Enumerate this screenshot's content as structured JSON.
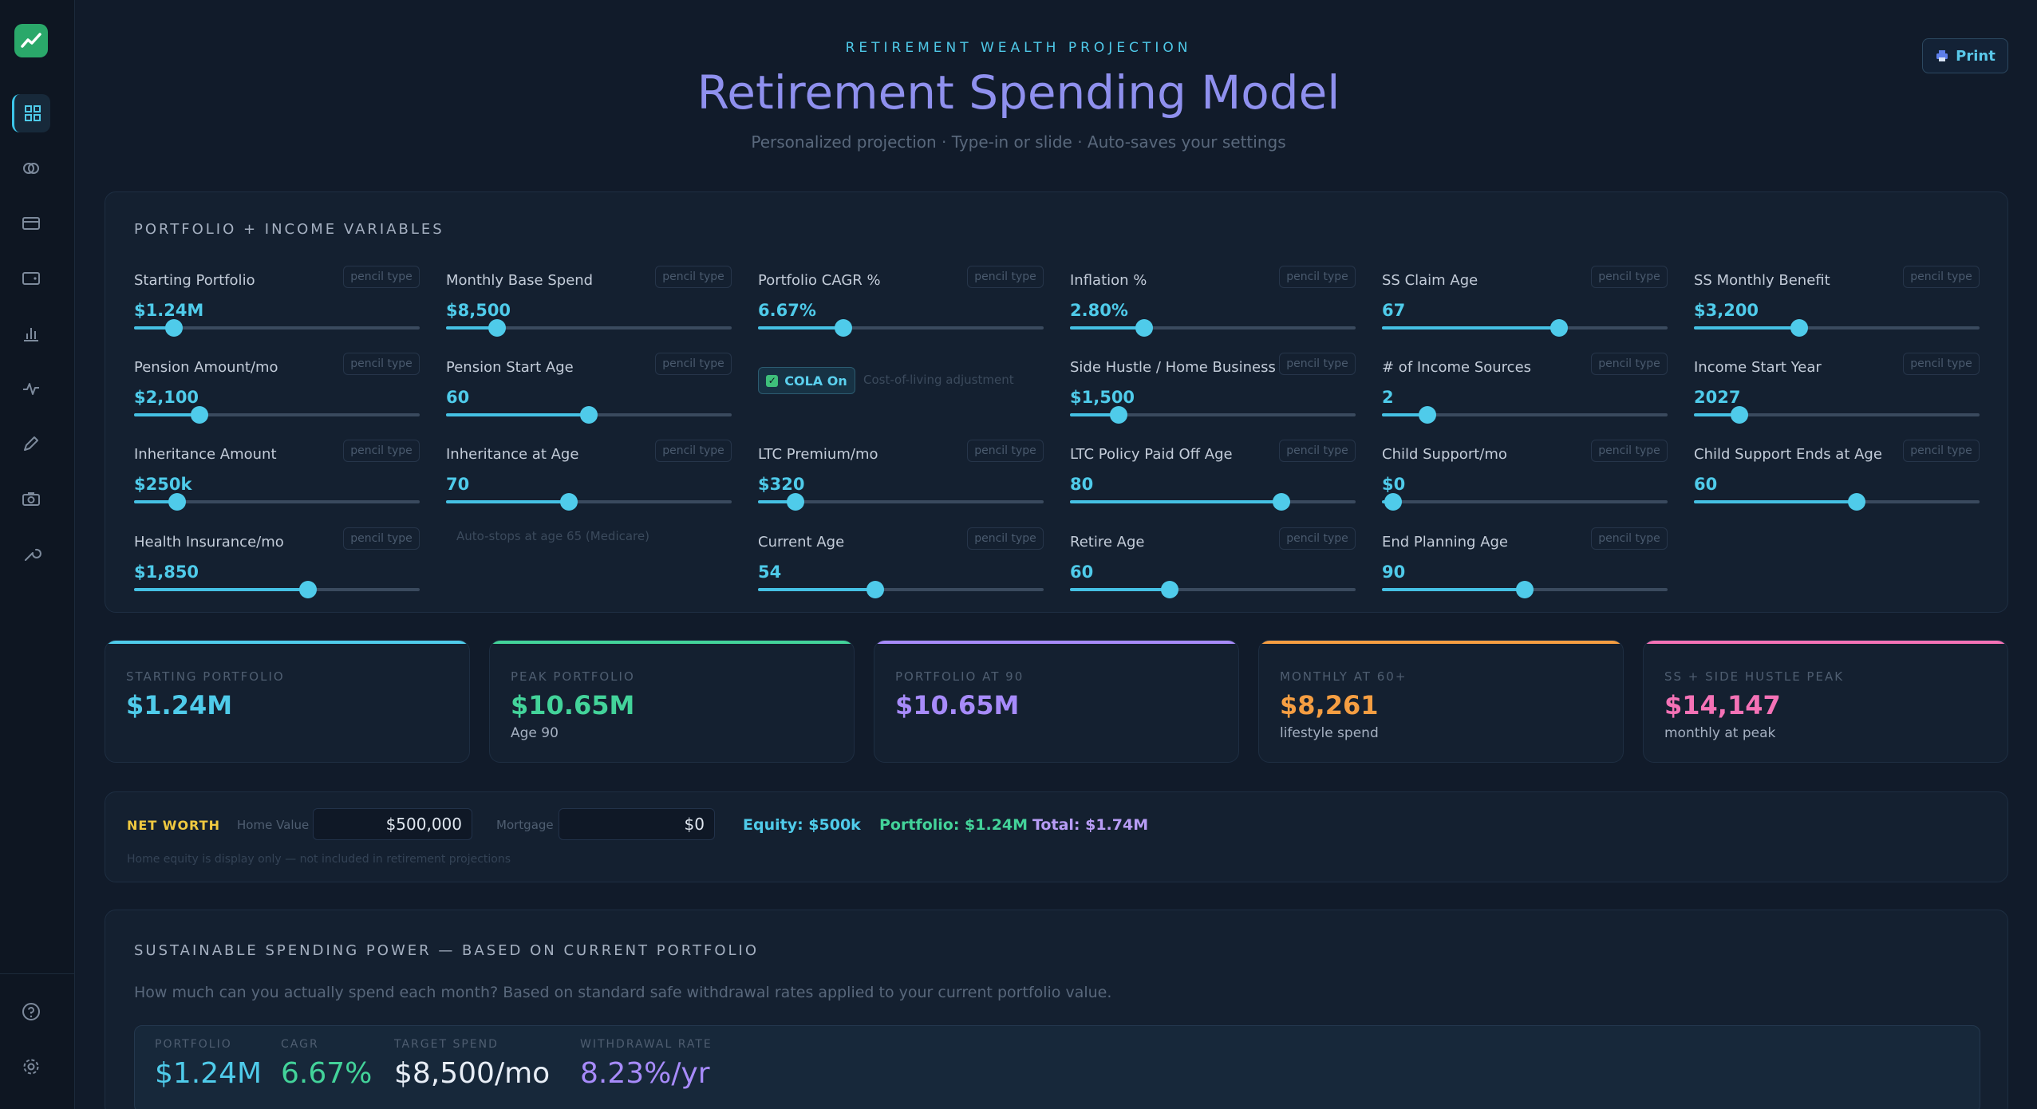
{
  "header": {
    "kicker": "RETIREMENT WEALTH PROJECTION",
    "title": "Retirement Spending Model",
    "subtitle": "Personalized projection · Type-in or slide · Auto-saves your settings",
    "print_label": "Print"
  },
  "sidebar": {
    "icons": [
      "grid-icon",
      "rings-icon",
      "card-icon",
      "wallet-icon",
      "bar-chart-icon",
      "pulse-icon",
      "pen-icon",
      "camera-icon",
      "wrench-icon",
      "help-icon",
      "settings-icon"
    ]
  },
  "variables": {
    "title": "PORTFOLIO + INCOME VARIABLES",
    "pencil_label": "pencil type",
    "items": [
      {
        "label": "Starting Portfolio",
        "value": "$1.24M",
        "level": 0.14
      },
      {
        "label": "Monthly Base Spend",
        "value": "$8,500",
        "level": 0.18
      },
      {
        "label": "Portfolio CAGR %",
        "value": "6.67%",
        "level": 0.3
      },
      {
        "label": "Inflation %",
        "value": "2.80%",
        "level": 0.26
      },
      {
        "label": "SS Claim Age",
        "value": "67",
        "level": 0.62
      },
      {
        "label": "SS Monthly Benefit",
        "value": "$3,200",
        "level": 0.37
      },
      {
        "label": "Pension Amount/mo",
        "value": "$2,100",
        "level": 0.23
      },
      {
        "label": "Pension Start Age",
        "value": "60",
        "level": 0.5
      },
      {
        "label": "Side Hustle / Home Business",
        "value": "$1,500",
        "level": 0.17
      },
      {
        "label": "# of Income Sources",
        "value": "2",
        "level": 0.16
      },
      {
        "label": "Income Start Year",
        "value": "2027",
        "level": 0.16
      },
      {
        "label": "Inheritance Amount",
        "value": "$250k",
        "level": 0.15
      },
      {
        "label": "Inheritance at Age",
        "value": "70",
        "level": 0.43
      },
      {
        "label": "LTC Premium/mo",
        "value": "$320",
        "level": 0.13
      },
      {
        "label": "LTC Policy Paid Off Age",
        "value": "80",
        "level": 0.74
      },
      {
        "label": "Child Support/mo",
        "value": "$0",
        "level": 0.04
      },
      {
        "label": "Child Support Ends at Age",
        "value": "60",
        "level": 0.57
      },
      {
        "label": "Health Insurance/mo",
        "value": "$1,850",
        "level": 0.61
      },
      {
        "label": "Current Age",
        "value": "54",
        "level": 0.41
      },
      {
        "label": "Retire Age",
        "value": "60",
        "level": 0.35
      },
      {
        "label": "End Planning Age",
        "value": "90",
        "level": 0.5
      }
    ],
    "cola": {
      "label": "COLA On",
      "note": "Cost-of-living adjustment"
    },
    "medicare_note": "Auto-stops at age 65 (Medicare)"
  },
  "stats": [
    {
      "label": "STARTING PORTFOLIO",
      "value": "$1.24M",
      "sub": "",
      "color": "#4fcbea"
    },
    {
      "label": "PEAK PORTFOLIO",
      "value": "$10.65M",
      "sub": "Age 90",
      "color": "#43d39a"
    },
    {
      "label": "PORTFOLIO AT 90",
      "value": "$10.65M",
      "sub": "",
      "color": "#a78bfa"
    },
    {
      "label": "MONTHLY AT 60+",
      "value": "$8,261",
      "sub": "lifestyle spend",
      "color": "#f59e42"
    },
    {
      "label": "SS + SIDE HUSTLE PEAK",
      "value": "$14,147",
      "sub": "monthly at peak",
      "color": "#f472b6"
    }
  ],
  "net_worth": {
    "label": "NET WORTH",
    "home_label": "Home Value",
    "home_value": "$500,000",
    "mortgage_label": "Mortgage",
    "mortgage_value": "$0",
    "equity": "Equity: $500k",
    "portfolio": "Portfolio: $1.24M",
    "total": "Total: $1.74M",
    "note": "Home equity is display only — not included in retirement projections"
  },
  "spending_power": {
    "title": "SUSTAINABLE SPENDING POWER — BASED ON CURRENT PORTFOLIO",
    "description": "How much can you actually spend each month? Based on standard safe withdrawal rates applied to your current portfolio value.",
    "metrics": [
      {
        "label": "PORTFOLIO",
        "value": "$1.24M",
        "color": "#4fcbea"
      },
      {
        "label": "CAGR",
        "value": "6.67%",
        "color": "#43d39a"
      },
      {
        "label": "TARGET SPEND",
        "value": "$8,500/mo",
        "color": "#e8eef6"
      },
      {
        "label": "WITHDRAWAL RATE",
        "value": "8.23%/yr",
        "color": "#a78bfa"
      }
    ]
  }
}
